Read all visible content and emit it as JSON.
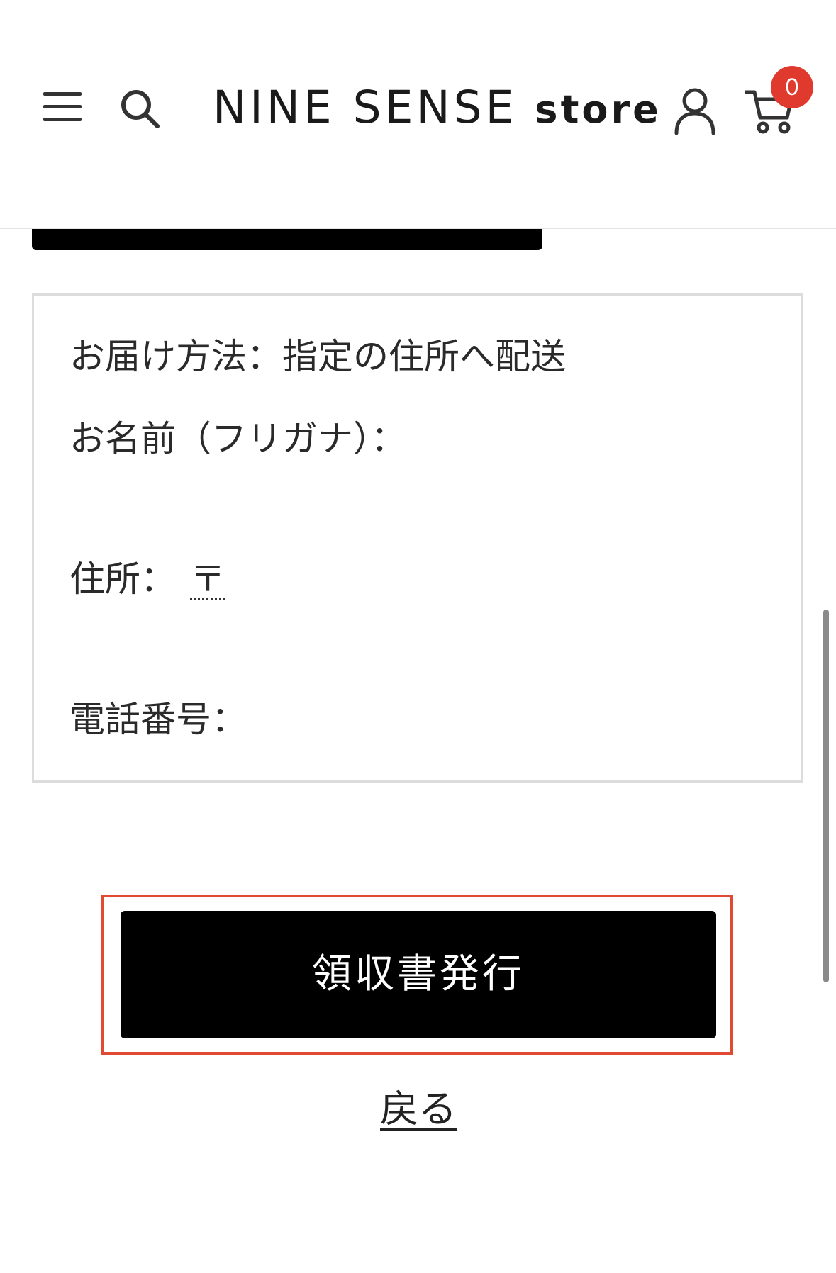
{
  "header": {
    "logo_brand": "NINE SENSE",
    "logo_suffix": "store",
    "cart_count": "0"
  },
  "delivery": {
    "method": "お届け方法：指定の住所へ配送",
    "name_label": "お名前（フリガナ）：",
    "address_label": "住所：",
    "postal_mark": "〒",
    "phone_label": "電話番号："
  },
  "actions": {
    "issue_receipt": "領収書発行",
    "back": "戻る"
  },
  "colors": {
    "badge": "#e03a2f",
    "highlight": "#e04a33",
    "button_bg": "#000000"
  },
  "icons": {
    "menu": "hamburger-menu-icon",
    "search": "search-icon",
    "account": "user-icon",
    "cart": "cart-icon"
  }
}
